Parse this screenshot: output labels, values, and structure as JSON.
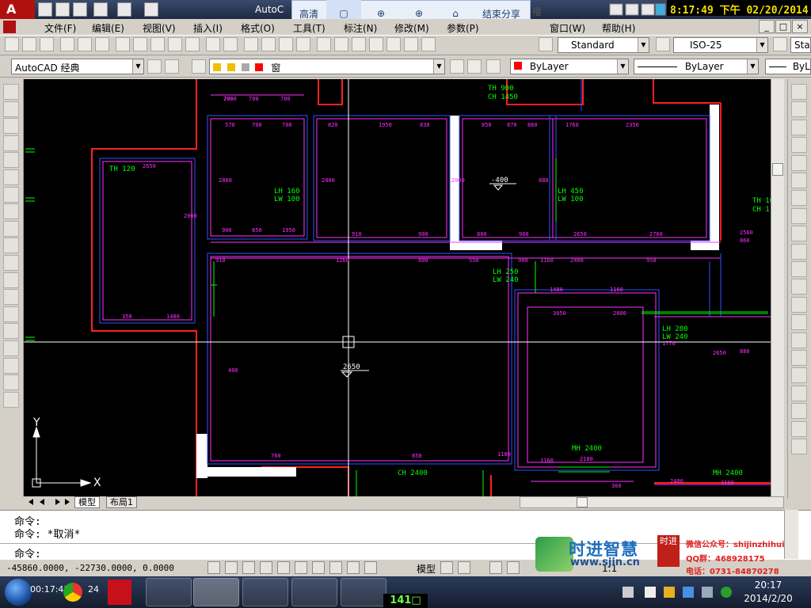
{
  "app": {
    "title": "AutoC",
    "logo_glyph": "A",
    "window_controls": [
      "_",
      "□",
      "×"
    ]
  },
  "clock_overlay": "8:17:49 下午 02/20/2014",
  "share_toolbar": {
    "items": [
      "高清",
      "▢",
      "⊕",
      "⊕",
      "⌂",
      "结束分享"
    ],
    "extra": "播"
  },
  "menu": [
    "文件(F)",
    "编辑(E)",
    "视图(V)",
    "插入(I)",
    "格式(O)",
    "工具(T)",
    "标注(N)",
    "修改(M)",
    "参数(P)",
    "窗口(W)",
    "帮助(H)"
  ],
  "toolbar1": {
    "text_style": "Standard",
    "dim_style": "ISO-25",
    "table_style": "Sta"
  },
  "toolbar2": {
    "workspace": "AutoCAD 经典",
    "layer": "窗",
    "color": "ByLayer",
    "linetype": "ByLayer",
    "lineweight": "ByL"
  },
  "drawing": {
    "labels": [
      {
        "text": "TH 900",
        "color": "#00ff00"
      },
      {
        "text": "CH 1450",
        "color": "#00ff00"
      },
      {
        "text": "TH 120",
        "color": "#00ff00"
      },
      {
        "text": "LH 160",
        "color": "#00ff00"
      },
      {
        "text": "LW 100",
        "color": "#00ff00"
      },
      {
        "text": "-400",
        "color": "#ffffff"
      },
      {
        "text": "LH 450",
        "color": "#00ff00"
      },
      {
        "text": "LW 100",
        "color": "#00ff00"
      },
      {
        "text": "TH 10",
        "color": "#00ff00"
      },
      {
        "text": "CH 1",
        "color": "#00ff00"
      },
      {
        "text": "LH 250",
        "color": "#00ff00"
      },
      {
        "text": "LW 240",
        "color": "#00ff00"
      },
      {
        "text": "LH 280",
        "color": "#00ff00"
      },
      {
        "text": "LW 240",
        "color": "#00ff00"
      },
      {
        "text": "2650",
        "color": "#ffffff"
      },
      {
        "text": "MH 2400",
        "color": "#00ff00"
      },
      {
        "text": "CH 2400",
        "color": "#00ff00"
      },
      {
        "text": "MH 2400",
        "color": "#00ff00"
      }
    ],
    "dims": [
      "700",
      "700",
      "700",
      "2650",
      "570",
      "700",
      "700",
      "820",
      "1950",
      "830",
      "850",
      "870",
      "860",
      "1760",
      "2350",
      "2000",
      "2800",
      "2000",
      "2000",
      "880",
      "900",
      "850",
      "1950",
      "910",
      "900",
      "800",
      "900",
      "2650",
      "2760",
      "910",
      "1260",
      "800",
      "550",
      "900",
      "1160",
      "2400",
      "950",
      "350",
      "1480",
      "1480",
      "1160",
      "3050",
      "2800",
      "760",
      "850",
      "1180",
      "1160",
      "2180",
      "360",
      "2400",
      "3100",
      "2650",
      "880",
      "1770",
      "2560",
      "860",
      "400",
      "2000"
    ],
    "ucs": {
      "x": "X",
      "y": "Y"
    }
  },
  "tabs": [
    "模型",
    "布局1"
  ],
  "command": {
    "line1": "命令:",
    "line2": "命令: *取消*",
    "prompt": "命令:"
  },
  "status": {
    "coords": "-45860.0000, -22730.0000, 0.0000",
    "model": "模型",
    "scale": "1:1"
  },
  "watermark": {
    "brand": "时进智慧",
    "site": "www.sjin.cn",
    "seal": "时进",
    "wechat": "微信公众号：shijinzhihui",
    "qq": "QQ群：468928175",
    "phone": "电话：0731-84870278"
  },
  "taskbar": {
    "timer": "00:17:41",
    "count": "24",
    "badge": "141□",
    "time": "20:17",
    "date": "2014/2/20"
  }
}
